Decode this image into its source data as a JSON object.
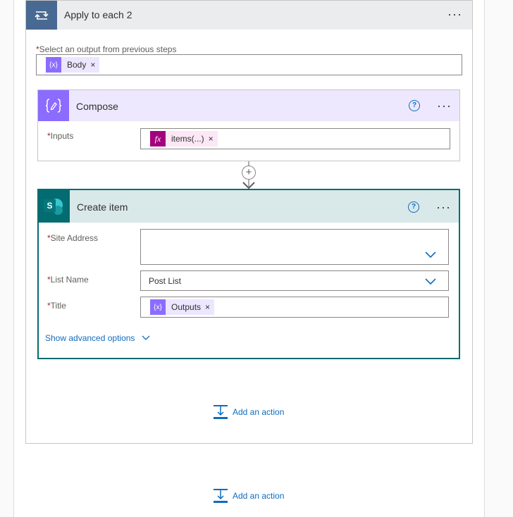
{
  "scope": {
    "title": "Apply to each 2",
    "icon": "loop-icon",
    "menu": "···",
    "output_label": "Select an output from previous steps",
    "required_mark": "*",
    "token": {
      "label": "Body",
      "icon": "{x}",
      "remove": "×"
    }
  },
  "compose": {
    "title": "Compose",
    "icon": "compose-icon",
    "help": "?",
    "menu": "···",
    "inputs_label": "Inputs",
    "required_mark": "*",
    "token": {
      "label": "items(...)",
      "icon": "fx",
      "remove": "×"
    }
  },
  "insert_step": {
    "icon": "plus-icon"
  },
  "create_item": {
    "title": "Create item",
    "icon": "sharepoint-icon",
    "icon_letter": "S",
    "help": "?",
    "menu": "···",
    "required_mark": "*",
    "site_address_label": "Site Address",
    "list_name_label": "List Name",
    "list_name_value": "Post List",
    "title_label": "Title",
    "title_token": {
      "label": "Outputs",
      "icon": "{x}",
      "remove": "×"
    },
    "advanced": "Show advanced options"
  },
  "add_action_inner": "Add an action",
  "add_action_outer": "Add an action",
  "colors": {
    "scope_accent": "#486991",
    "compose_accent": "#8c6cff",
    "sharepoint_accent": "#036c70",
    "fx_accent": "#a4007e",
    "link": "#0f6cbd"
  }
}
